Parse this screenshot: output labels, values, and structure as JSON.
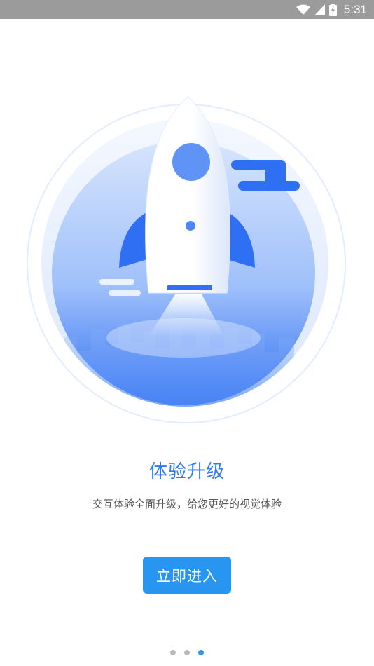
{
  "status_bar": {
    "time": "5:31",
    "icons": [
      "wifi-icon",
      "signal-icon",
      "battery-icon"
    ]
  },
  "hero": {
    "illustration": "rocket-launch-illustration"
  },
  "content": {
    "title": "体验升级",
    "subtitle": "交互体验全面升级，给您更好的视觉体验"
  },
  "actions": {
    "enter_label": "立即进入"
  },
  "pager": {
    "total": 3,
    "current": 3
  },
  "colors": {
    "accent": "#2896f0",
    "title": "#2f7bf0",
    "status_bar": "#9b9b9b"
  }
}
